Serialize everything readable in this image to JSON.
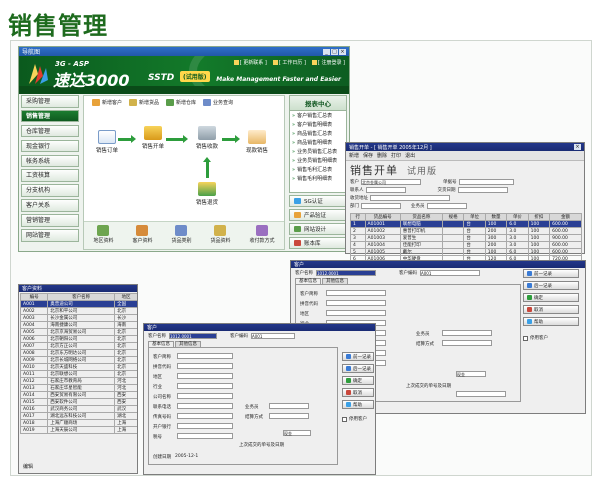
{
  "page_title": "销售管理",
  "main_window": {
    "title": "导航图",
    "brand": {
      "subtitle": "3G - ASP",
      "name": "速达3000",
      "code": "SSTD",
      "edition": "(试用版)"
    },
    "slogan": "Make Management Faster and Easier",
    "top_links": [
      "[ 更新联系 ]",
      "[ 工作日历 ]",
      "[ 注册登录 ]"
    ],
    "nav": [
      {
        "label": "采购管理",
        "active": false
      },
      {
        "label": "销售管理",
        "active": true
      },
      {
        "label": "仓库管理",
        "active": false
      },
      {
        "label": "现金银行",
        "active": false
      },
      {
        "label": "帐务系统",
        "active": false
      },
      {
        "label": "工资核算",
        "active": false
      },
      {
        "label": "分支机构",
        "active": false
      },
      {
        "label": "客户关系",
        "active": false
      },
      {
        "label": "营销管理",
        "active": false
      },
      {
        "label": "网站管理",
        "active": false
      }
    ],
    "quick_actions": [
      "新增客户",
      "新增货品",
      "新增仓库",
      "业务查询"
    ],
    "flow": {
      "order": "销售订单",
      "issue": "销售开单",
      "receipt": "销售收款",
      "cash": "现款销售",
      "return": "销售退货"
    },
    "bottom_actions": [
      "地区资料",
      "客户资料",
      "货品类别",
      "货品资料",
      "收付款方式"
    ],
    "report_center": {
      "title": "报表中心",
      "items": [
        "客户销售汇总表",
        "客户销售明细表",
        "商品销售汇总表",
        "商品销售明细表",
        "业务员销售汇总表",
        "业务员销售明细表",
        "销售毛利汇总表",
        "销售毛利明细表"
      ]
    },
    "side_buttons": [
      "SG认证",
      "产品验证",
      "网站设计",
      "账本库"
    ]
  },
  "po_window": {
    "title": "销售开单 - [ 销售开单 2005年12月 ]",
    "toolbar": [
      "新增",
      "保存",
      "删除",
      "打印",
      "退出"
    ],
    "heading": "销售开单",
    "edition": "试用版",
    "fields": [
      {
        "label": "客户",
        "value": "北京金属公司"
      },
      {
        "label": "联系人",
        "value": ""
      },
      {
        "label": "收货地址",
        "value": ""
      },
      {
        "label": "部门",
        "value": ""
      },
      {
        "label": "业务员",
        "value": ""
      },
      {
        "label": "交货日期",
        "value": ""
      },
      {
        "label": "单据号",
        "value": ""
      }
    ],
    "columns": [
      "行",
      "货品编号",
      "货品名称",
      "规格",
      "单位",
      "数量",
      "单价",
      "折扣",
      "金额"
    ],
    "rows": [
      [
        "1",
        "A01001",
        "联想电脑",
        "",
        "台",
        "100",
        "6.0",
        "100",
        "600.00"
      ],
      [
        "2",
        "A01002",
        "惠普打印机",
        "",
        "台",
        "200",
        "3.0",
        "100",
        "600.00"
      ],
      [
        "3",
        "A01003",
        "爱普生",
        "",
        "台",
        "300",
        "3.0",
        "100",
        "900.00"
      ],
      [
        "4",
        "A01004",
        "佳能打印",
        "",
        "台",
        "200",
        "3.0",
        "100",
        "600.00"
      ],
      [
        "5",
        "A01005",
        "戴尔",
        "",
        "台",
        "100",
        "6.0",
        "100",
        "600.00"
      ],
      [
        "6",
        "A01006",
        "中华硬盘",
        "",
        "台",
        "120",
        "6.0",
        "100",
        "720.00"
      ]
    ]
  },
  "list_window": {
    "title": "客户资料",
    "columns": [
      "编号",
      "客户名称",
      "地区"
    ],
    "rows": [
      [
        "A001",
        "奥普迪公司",
        "全国"
      ],
      [
        "A002",
        "北京和平公司",
        "北京"
      ],
      [
        "A003",
        "长沙金属公司",
        "长沙"
      ],
      [
        "A004",
        "海南捷康公司",
        "海南"
      ],
      [
        "A005",
        "北京京海贸易公司",
        "北京"
      ],
      [
        "A006",
        "北京朝阳公司",
        "北京"
      ],
      [
        "A007",
        "北京方正公司",
        "北京"
      ],
      [
        "A008",
        "北京东方明达公司",
        "北京"
      ],
      [
        "A009",
        "北京长城网络公司",
        "北京"
      ],
      [
        "A010",
        "北京天盛科技",
        "北京"
      ],
      [
        "A011",
        "北京联想公司",
        "北京"
      ],
      [
        "A012",
        "石家庄市教育局",
        "河北"
      ],
      [
        "A013",
        "石家庄华星智能",
        "河北"
      ],
      [
        "A014",
        "西安贸易有限公司",
        "西安"
      ],
      [
        "A015",
        "西安软件公司",
        "西安"
      ],
      [
        "A016",
        "武汉商务公司",
        "武汉"
      ],
      [
        "A017",
        "湖北远东科技公司",
        "湖北"
      ],
      [
        "A018",
        "上海广顺商场",
        "上海"
      ],
      [
        "A019",
        "上海天辰公司",
        "上海"
      ]
    ],
    "footer": "编辑"
  },
  "cust_window_front": {
    "title": "客户",
    "code_label": "客户名称",
    "code_value": "1012.0001",
    "id_label": "客户编码",
    "id_value": "A001",
    "tabs": [
      "基本信息",
      "其他信息"
    ],
    "labels": [
      "客户简称",
      "拼音代码",
      "地区",
      "行业",
      "公司名称",
      "联系电话",
      "传真号码",
      "开户银行",
      "税号"
    ],
    "buttons": [
      "前一记录",
      "后一记录",
      "确定",
      "取消",
      "帮助"
    ],
    "dropdown_labels": [
      "业务员",
      "结算方式"
    ],
    "dropdown_value": "现金",
    "checkbox": "停用客户",
    "bottom": "上次成交的单号及日期",
    "date_label": "创建日期",
    "date_value": "2005-12-1"
  },
  "cust_window_back": {
    "title": "客户",
    "code_label": "客户名称",
    "code_value": "1012.0001",
    "id_label": "客户编码",
    "id_value": "A001",
    "tabs": [
      "基本信息",
      "其他信息"
    ],
    "labels": [
      "客户简称",
      "拼音代码",
      "地区",
      "行业",
      "公司名称",
      "联系电话",
      "传真号码",
      "开户银行"
    ],
    "buttons": [
      "前一记录",
      "后一记录",
      "确定",
      "取消",
      "帮助"
    ],
    "checkbox": "停用客户",
    "dropdown_labels": [
      "业务员",
      "结算方式"
    ],
    "dropdown_value": "现金",
    "bottom": "上次成交的单号及日期"
  }
}
